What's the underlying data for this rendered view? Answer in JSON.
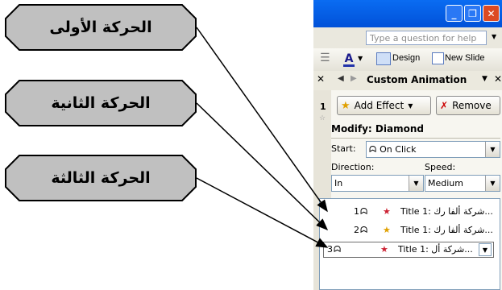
{
  "callouts": [
    {
      "text": "الحركة الأولى"
    },
    {
      "text": "الحركة الثانية"
    },
    {
      "text": "الحركة الثالثة"
    }
  ],
  "window": {
    "help_placeholder": "Type a question for help",
    "toolbar": {
      "design_label": "Design",
      "new_slide_label": "New Slide"
    },
    "task_pane_title": "Custom Animation",
    "slide_number": "1",
    "add_effect_label": "Add Effect",
    "remove_label": "Remove",
    "modify_label": "Modify: Diamond",
    "start_label": "Start:",
    "start_value": "On Click",
    "direction_label": "Direction:",
    "direction_value": "In",
    "speed_label": "Speed:",
    "speed_value": "Medium",
    "animations": [
      {
        "order": "1",
        "text": "Title 1: شركة ألفا رك..."
      },
      {
        "order": "2",
        "text": "Title 1: شركة ألفا رك..."
      },
      {
        "order": "3",
        "text": "Title 1: شركة أل..."
      }
    ]
  },
  "colors": {
    "titlebar": "#0a5ee0",
    "callout_fill": "#c0c0c0",
    "arrow": "#000000"
  }
}
